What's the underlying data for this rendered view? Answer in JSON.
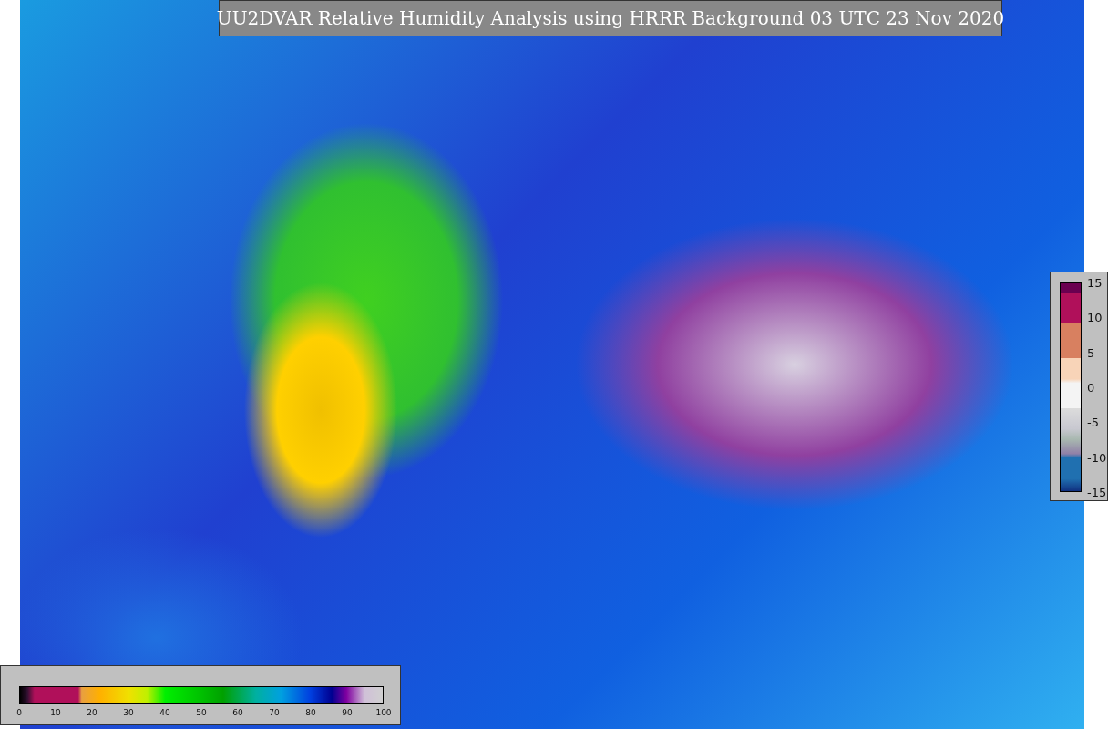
{
  "title": "UU2DVAR Relative Humidity Analysis using HRRR Background 03 UTC 23 Nov 2020",
  "humidity_legend": {
    "ticks": [
      "0",
      "10",
      "20",
      "30",
      "40",
      "50",
      "60",
      "70",
      "80",
      "90",
      "100"
    ]
  },
  "difference_legend": {
    "ticks": [
      "15",
      "10",
      "5",
      "0",
      "-5",
      "-10",
      "-15"
    ]
  }
}
